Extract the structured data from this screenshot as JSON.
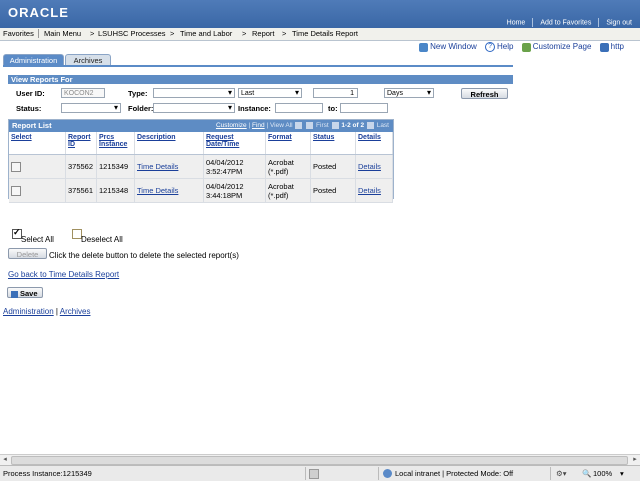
{
  "header": {
    "logo": "ORACLE",
    "links": [
      "Home",
      "Add to Favorites",
      "Sign out"
    ]
  },
  "menubar": {
    "items": [
      "Favorites",
      "Main Menu",
      "LSUHSC Processes",
      "Time and Labor",
      "Report",
      "Time Details Report"
    ]
  },
  "util_links": {
    "new_window": "New Window",
    "help": "Help",
    "customize": "Customize Page",
    "http": "http"
  },
  "tabs": [
    "Administration",
    "Archives"
  ],
  "view_reports": {
    "title": "View Reports For",
    "user_id_label": "User ID:",
    "user_id_value": "KOCON2",
    "type_label": "Type:",
    "type_value": "",
    "last_value": "Last",
    "number_value": "1",
    "unit_value": "Days",
    "refresh_label": "Refresh",
    "status_label": "Status:",
    "folder_label": "Folder:",
    "instance_label": "Instance:",
    "to_label": "to:"
  },
  "report_list": {
    "title": "Report List",
    "nav": {
      "customize": "Customize",
      "find": "Find",
      "view_all": "View All",
      "first": "First",
      "range": "1-2 of 2",
      "last": "Last"
    },
    "columns": [
      "Select",
      "Report ID",
      "Prcs Instance",
      "Description",
      "Request Date/Time",
      "Format",
      "Status",
      "Details"
    ],
    "rows": [
      {
        "report_id": "375562",
        "prcs_instance": "1215349",
        "description": "Time Details",
        "date_line1": "04/04/2012",
        "date_line2": "3:52:47PM",
        "format_line1": "Acrobat",
        "format_line2": "(*.pdf)",
        "status": "Posted",
        "details": "Details"
      },
      {
        "report_id": "375561",
        "prcs_instance": "1215348",
        "description": "Time Details",
        "date_line1": "04/04/2012",
        "date_line2": "3:44:18PM",
        "format_line1": "Acrobat",
        "format_line2": "(*.pdf)",
        "status": "Posted",
        "details": "Details"
      }
    ]
  },
  "actions": {
    "select_all": "Select All",
    "deselect_all": "Deselect All",
    "delete_label": "Delete",
    "delete_hint": "Click the delete button to delete the selected report(s)",
    "go_back": "Go back to Time Details Report",
    "save": "Save"
  },
  "footer_links": {
    "administration": "Administration",
    "separator": " | ",
    "archives": "Archives"
  },
  "statusbar": {
    "left": "Process Instance:1215349",
    "zone": "Local intranet | Protected Mode: Off",
    "zoom": "100%"
  },
  "colors": {
    "header": "#3a67a6",
    "accent": "#5e8cc4",
    "link": "#1a3f9a"
  }
}
